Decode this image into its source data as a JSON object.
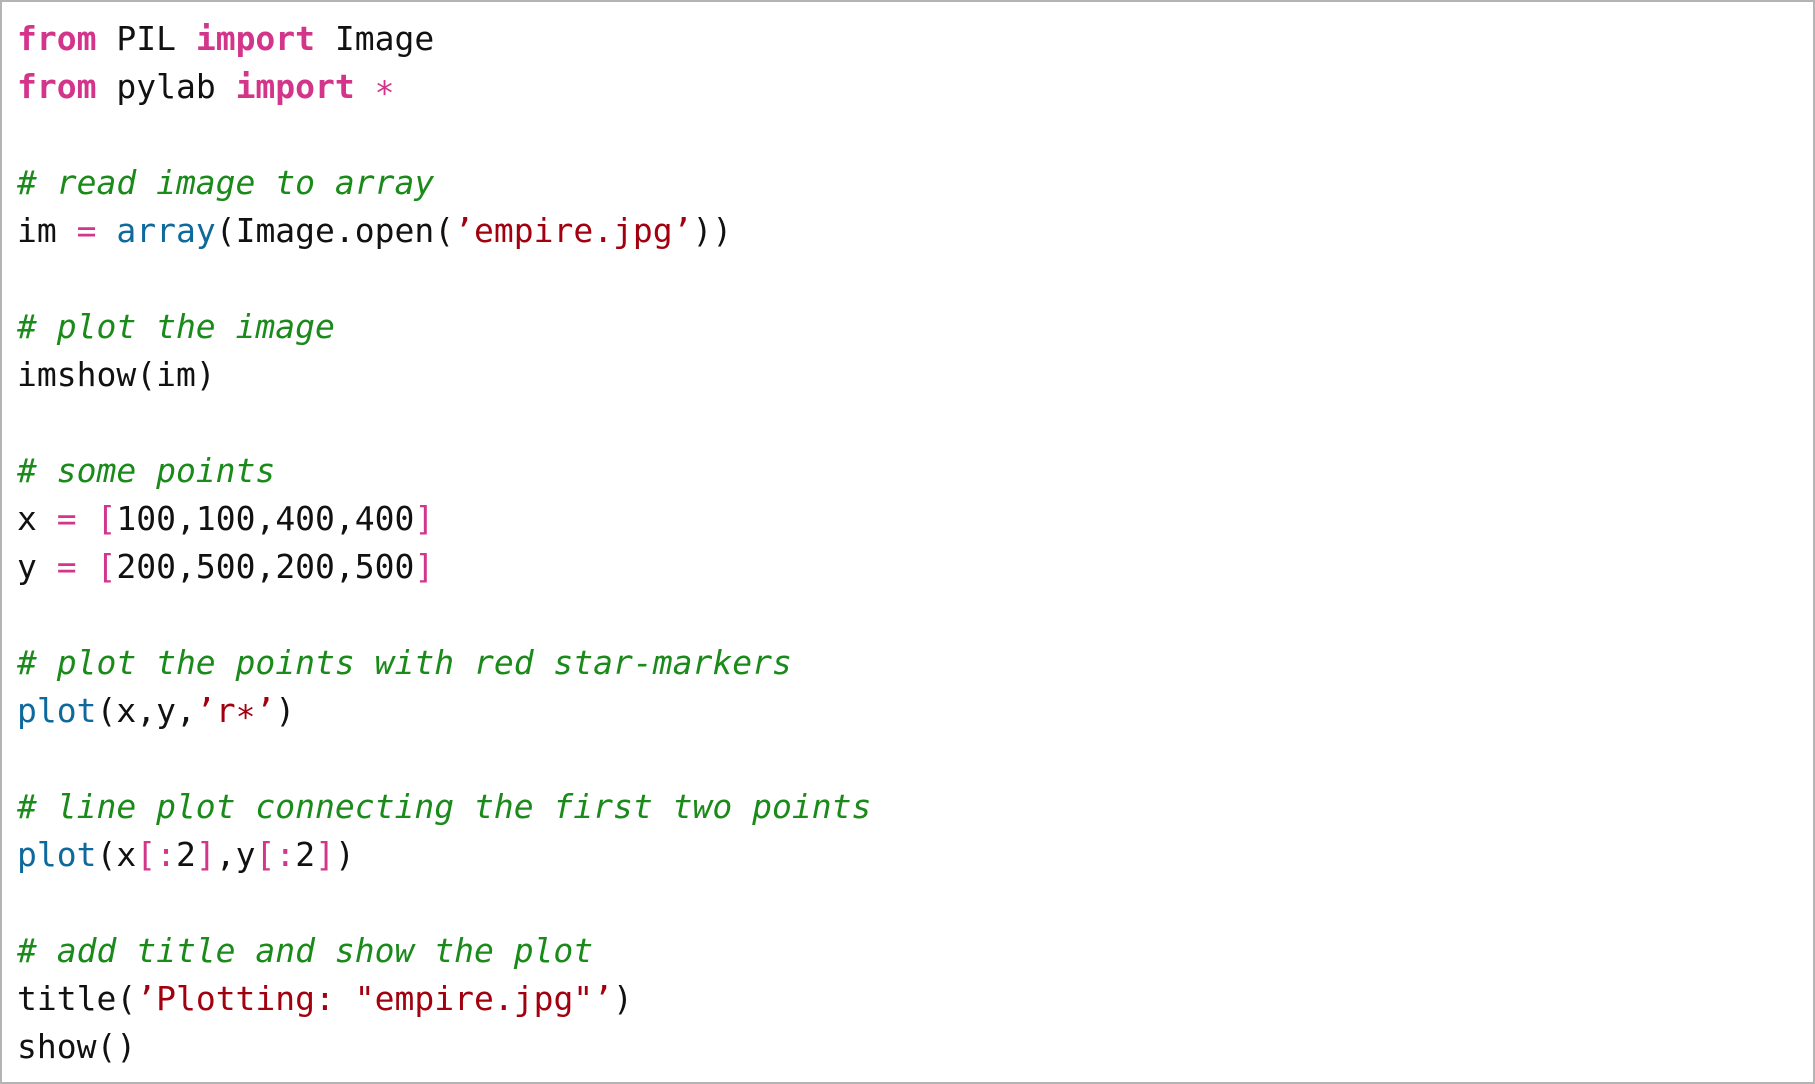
{
  "code": {
    "language": "python",
    "lines": [
      [
        {
          "t": "from",
          "k": "kw"
        },
        {
          "t": " PIL ",
          "k": "plain"
        },
        {
          "t": "import",
          "k": "kw"
        },
        {
          "t": " Image",
          "k": "plain"
        }
      ],
      [
        {
          "t": "from",
          "k": "kw"
        },
        {
          "t": " pylab ",
          "k": "plain"
        },
        {
          "t": "import",
          "k": "kw"
        },
        {
          "t": " ",
          "k": "plain"
        },
        {
          "t": "∗",
          "k": "op"
        }
      ],
      [],
      [
        {
          "t": "# read image to array",
          "k": "comment"
        }
      ],
      [
        {
          "t": "im ",
          "k": "plain"
        },
        {
          "t": "=",
          "k": "op"
        },
        {
          "t": " ",
          "k": "plain"
        },
        {
          "t": "array",
          "k": "builtin"
        },
        {
          "t": "(Image.open(",
          "k": "plain"
        },
        {
          "t": "’empire.jpg’",
          "k": "str"
        },
        {
          "t": "))",
          "k": "plain"
        }
      ],
      [],
      [
        {
          "t": "# plot the image",
          "k": "comment"
        }
      ],
      [
        {
          "t": "imshow(im)",
          "k": "plain"
        }
      ],
      [],
      [
        {
          "t": "# some points",
          "k": "comment"
        }
      ],
      [
        {
          "t": "x ",
          "k": "plain"
        },
        {
          "t": "=",
          "k": "op"
        },
        {
          "t": " ",
          "k": "plain"
        },
        {
          "t": "[",
          "k": "op"
        },
        {
          "t": "100,100,400,400",
          "k": "plain"
        },
        {
          "t": "]",
          "k": "op"
        }
      ],
      [
        {
          "t": "y ",
          "k": "plain"
        },
        {
          "t": "=",
          "k": "op"
        },
        {
          "t": " ",
          "k": "plain"
        },
        {
          "t": "[",
          "k": "op"
        },
        {
          "t": "200,500,200,500",
          "k": "plain"
        },
        {
          "t": "]",
          "k": "op"
        }
      ],
      [],
      [
        {
          "t": "# plot the points with red star-markers",
          "k": "comment"
        }
      ],
      [
        {
          "t": "plot",
          "k": "builtin"
        },
        {
          "t": "(x,y,",
          "k": "plain"
        },
        {
          "t": "’r∗’",
          "k": "str"
        },
        {
          "t": ")",
          "k": "plain"
        }
      ],
      [],
      [
        {
          "t": "# line plot connecting the first two points",
          "k": "comment"
        }
      ],
      [
        {
          "t": "plot",
          "k": "builtin"
        },
        {
          "t": "(x",
          "k": "plain"
        },
        {
          "t": "[:",
          "k": "op"
        },
        {
          "t": "2",
          "k": "plain"
        },
        {
          "t": "]",
          "k": "op"
        },
        {
          "t": ",y",
          "k": "plain"
        },
        {
          "t": "[:",
          "k": "op"
        },
        {
          "t": "2",
          "k": "plain"
        },
        {
          "t": "]",
          "k": "op"
        },
        {
          "t": ")",
          "k": "plain"
        }
      ],
      [],
      [
        {
          "t": "# add title and show the plot",
          "k": "comment"
        }
      ],
      [
        {
          "t": "title(",
          "k": "plain"
        },
        {
          "t": "’Plotting: \"empire.jpg\"’",
          "k": "str"
        },
        {
          "t": ")",
          "k": "plain"
        }
      ],
      [
        {
          "t": "show()",
          "k": "plain"
        }
      ]
    ]
  },
  "colors": {
    "keyword": "#d3358b",
    "operator": "#d3358b",
    "builtin": "#0e6a9c",
    "string": "#a3000f",
    "comment": "#1a8a1a",
    "text": "#111111",
    "border": "#b4b4b4",
    "background": "#ffffff"
  }
}
